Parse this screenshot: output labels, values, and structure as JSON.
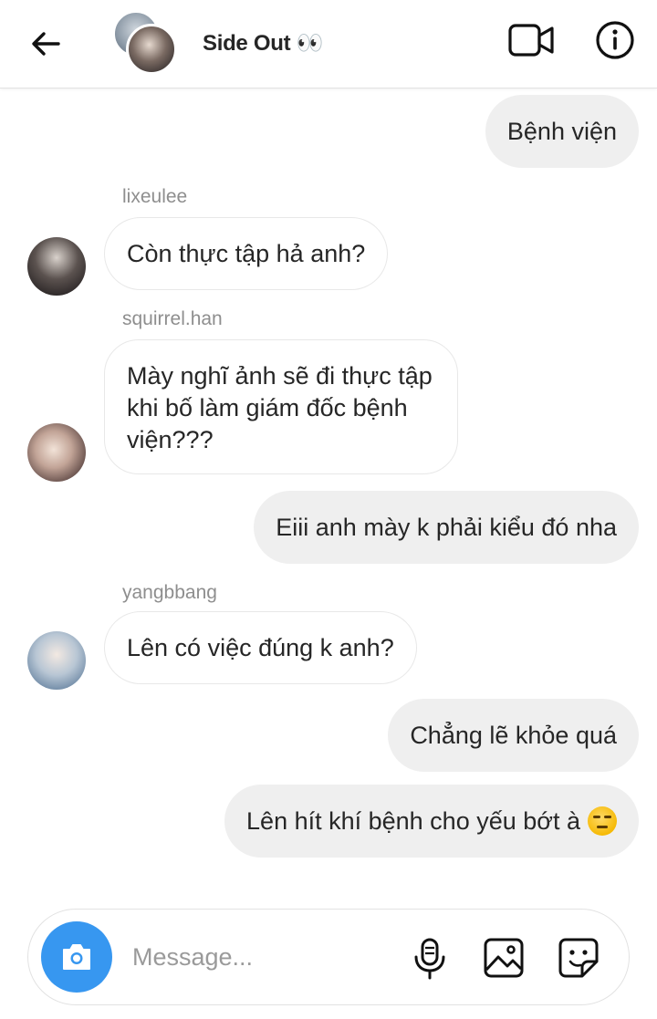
{
  "header": {
    "title": "Side Out 👀"
  },
  "messages": [
    {
      "type": "outgoing",
      "text": "Bệnh viện"
    },
    {
      "type": "incoming",
      "sender": "lixeulee",
      "text": "Còn thực tập hả anh?"
    },
    {
      "type": "incoming",
      "sender": "squirrel.han",
      "text": "Mày nghĩ ảnh sẽ đi thực tập khi bố làm giám đốc bệnh viện???"
    },
    {
      "type": "outgoing",
      "text": "Eiii anh mày k phải kiểu đó nha"
    },
    {
      "type": "incoming",
      "sender": "yangbbang",
      "text": "Lên có việc đúng k anh?"
    },
    {
      "type": "outgoing",
      "text": "Chẳng lẽ khỏe quá"
    },
    {
      "type": "outgoing",
      "text": "Lên hít khí bệnh cho yếu bớt à",
      "emoji": "unamused-face"
    }
  ],
  "composer": {
    "placeholder": "Message..."
  },
  "icons": {
    "back": "arrow-left-icon",
    "video": "video-call-icon",
    "info": "info-icon",
    "camera": "camera-icon",
    "mic": "microphone-icon",
    "gallery": "gallery-icon",
    "sticker": "sticker-icon"
  },
  "colors": {
    "accent": "#3797f0",
    "outgoing_bubble": "#efefef",
    "secondary_text": "#8e8e8e"
  }
}
